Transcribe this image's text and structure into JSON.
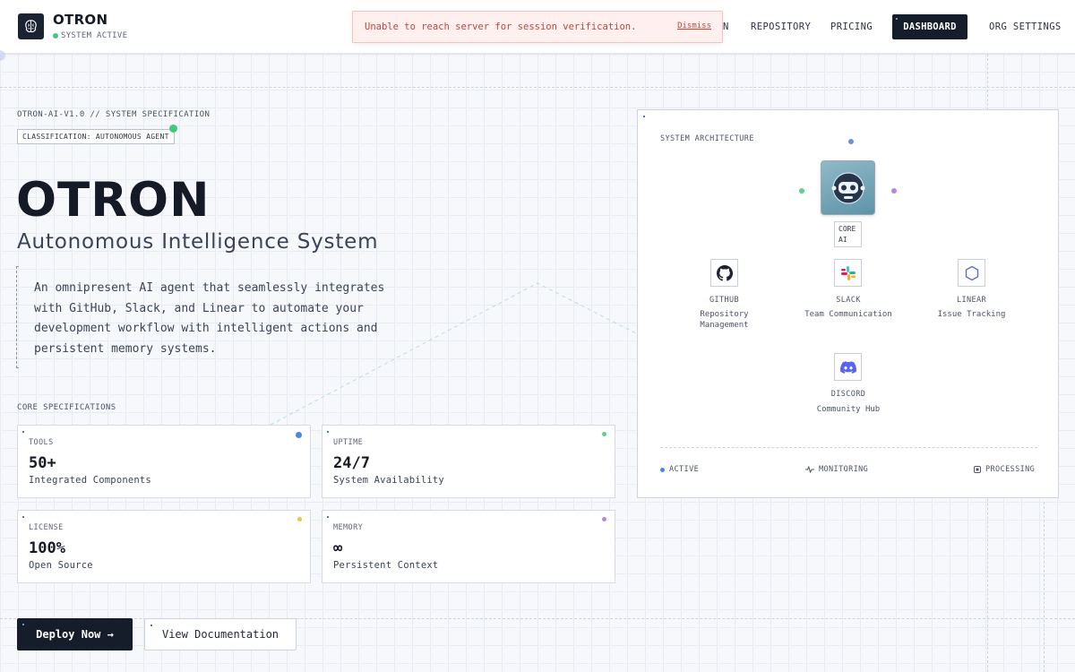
{
  "nav": {
    "brand": "OTRON",
    "status": "SYSTEM ACTIVE",
    "links": [
      "N",
      "REPOSITORY",
      "PRICING",
      "DASHBOARD",
      "ORG SETTINGS"
    ],
    "alert_text": "Unable to reach server for session verification.",
    "alert_dismiss": "Dismiss"
  },
  "hero": {
    "spec_line": "OTRON-AI-V1.0 // SYSTEM SPECIFICATION",
    "classification": "CLASSIFICATION: AUTONOMOUS AGENT",
    "title": "OTRON",
    "subtitle": "Autonomous Intelligence System",
    "description": "An omnipresent AI agent that seamlessly integrates with GitHub, Slack, and Linear to automate your development workflow with intelligent actions and persistent memory systems.",
    "core_label": "CORE SPECIFICATIONS"
  },
  "cards": [
    {
      "label": "TOOLS",
      "value": "50+",
      "desc": "Integrated Components",
      "color": "#4a86e8"
    },
    {
      "label": "UPTIME",
      "value": "24/7",
      "desc": "System Availability",
      "color": "#5fd08a"
    },
    {
      "label": "LICENSE",
      "value": "100%",
      "desc": "Open Source",
      "color": "#f3c04a"
    },
    {
      "label": "MEMORY",
      "value": "∞",
      "desc": "Persistent Context",
      "color": "#b388e0"
    }
  ],
  "actions": {
    "primary": "Deploy Now →",
    "secondary": "View Documentation"
  },
  "architecture": {
    "title": "SYSTEM ARCHITECTURE",
    "core_tag": "CORE AI",
    "tools": [
      {
        "name": "GITHUB",
        "desc": "Repository Management",
        "icon": "github-icon"
      },
      {
        "name": "SLACK",
        "desc": "Team Communication",
        "icon": "slack-icon"
      },
      {
        "name": "LINEAR",
        "desc": "Issue Tracking",
        "icon": "linear-icon"
      },
      {
        "name": "DISCORD",
        "desc": "Community Hub",
        "icon": "discord-icon"
      }
    ],
    "status": [
      "ACTIVE",
      "MONITORING",
      "PROCESSING"
    ]
  },
  "colors": {
    "accent_dark": "#151c2a",
    "active_green": "#3ecb7a",
    "alert_red": "#c2453a",
    "blue": "#4a86e8"
  }
}
